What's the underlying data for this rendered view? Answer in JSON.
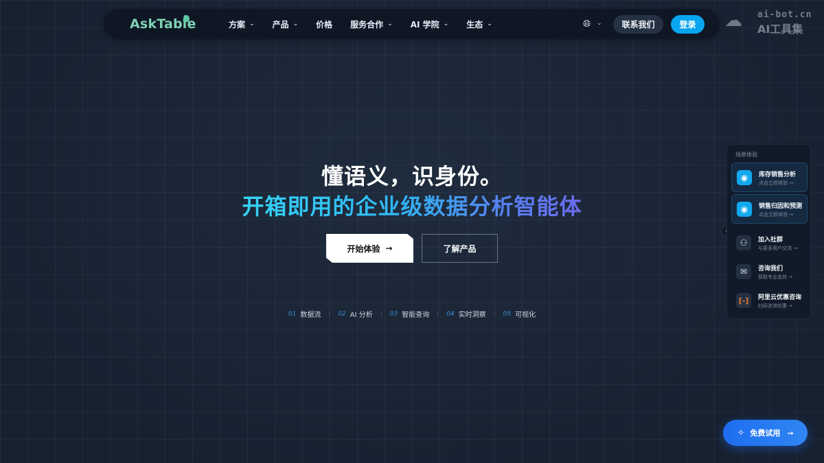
{
  "nav": {
    "logo": "AskTable",
    "items": [
      {
        "label": "方案",
        "dropdown": true
      },
      {
        "label": "产品",
        "dropdown": true
      },
      {
        "label": "价格",
        "dropdown": false
      },
      {
        "label": "服务合作",
        "dropdown": true
      },
      {
        "label": "AI 学院",
        "dropdown": true
      },
      {
        "label": "生态",
        "dropdown": true
      }
    ],
    "language_icon": "globe-icon",
    "contact_label": "联系我们",
    "login_label": "登录"
  },
  "watermark": {
    "top": "ai-bot.cn",
    "bottom": "AI工具集"
  },
  "hero": {
    "title": "懂语义，识身份。",
    "subtitle": "开箱即用的企业级数据分析智能体",
    "start_label": "开始体验",
    "learn_label": "了解产品"
  },
  "features": [
    {
      "num": "01",
      "label": "数据流"
    },
    {
      "num": "02",
      "label": "AI 分析"
    },
    {
      "num": "03",
      "label": "智能查询"
    },
    {
      "num": "04",
      "label": "实时洞察"
    },
    {
      "num": "05",
      "label": "可视化"
    }
  ],
  "side_panel": {
    "title": "场景体验",
    "items": [
      {
        "title": "库存销售分析",
        "sub": "点击立即体验 →",
        "icon": "eye-icon"
      },
      {
        "title": "销售归因和预测",
        "sub": "点击立即体验 →",
        "icon": "eye-icon"
      },
      {
        "title": "加入社群",
        "sub": "与更多用户交流 →",
        "icon": "users-icon"
      },
      {
        "title": "咨询我们",
        "sub": "获取专业支持 →",
        "icon": "mail-icon"
      },
      {
        "title": "阿里云优惠咨询",
        "sub": "扫码咨询优惠 →",
        "icon": "aliyun-icon"
      }
    ]
  },
  "trial_label": "免费试用",
  "colors": {
    "accent": "#0aa5f0",
    "trial": "#1f6df0",
    "background": "#1a2535"
  }
}
